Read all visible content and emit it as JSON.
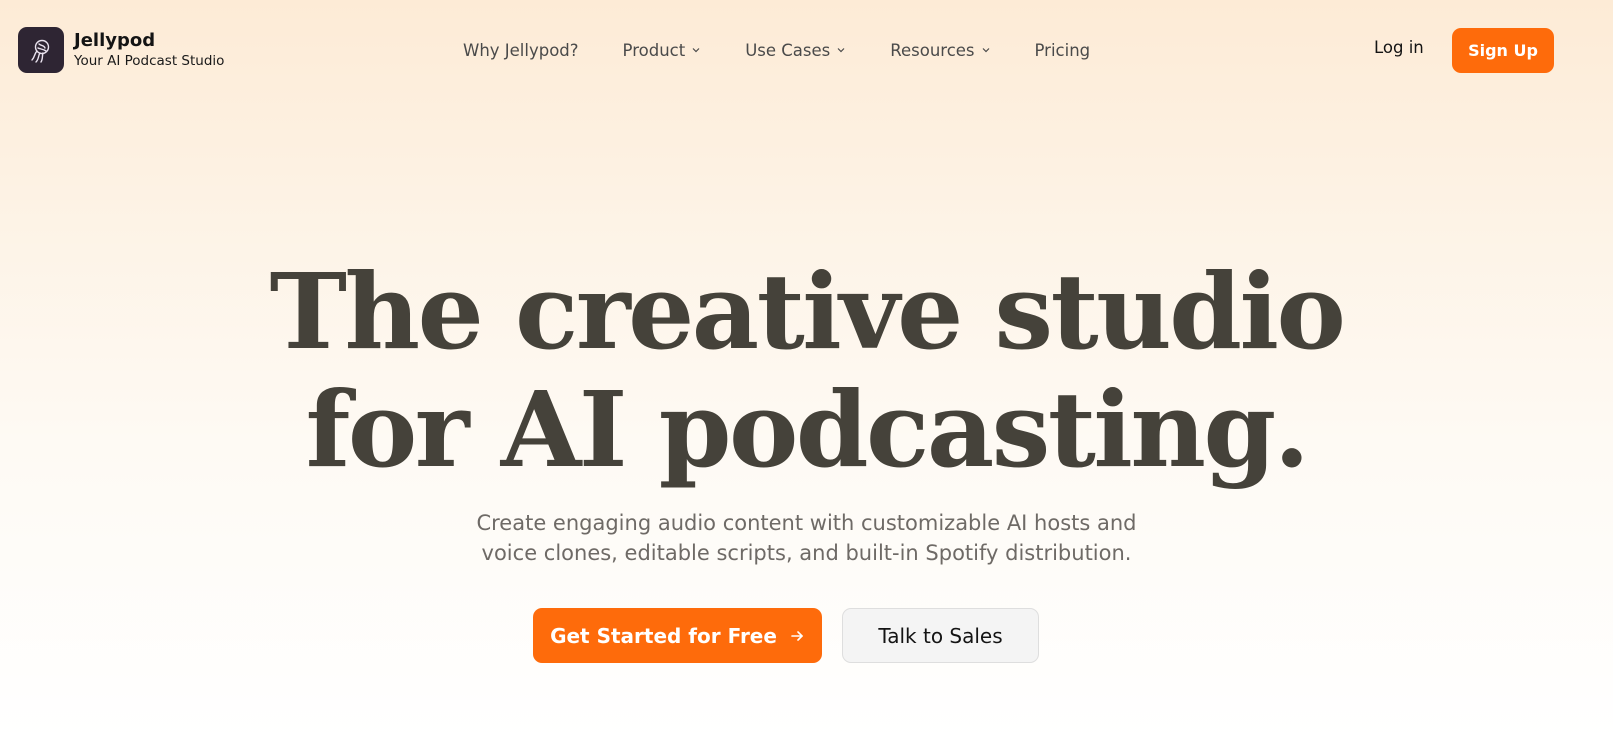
{
  "brand": {
    "name": "Jellypod",
    "tagline": "Your AI Podcast Studio",
    "logo_icon": "jellyfish-logo-icon"
  },
  "nav": {
    "items": [
      {
        "label": "Why Jellypod?",
        "has_dropdown": false
      },
      {
        "label": "Product",
        "has_dropdown": true
      },
      {
        "label": "Use Cases",
        "has_dropdown": true
      },
      {
        "label": "Resources",
        "has_dropdown": true
      },
      {
        "label": "Pricing",
        "has_dropdown": false
      }
    ]
  },
  "auth": {
    "login_label": "Log in",
    "signup_label": "Sign Up"
  },
  "hero": {
    "title_line1": "The creative studio",
    "title_line2": "for AI podcasting.",
    "subtitle_line1": "Create engaging audio content with customizable AI hosts and",
    "subtitle_line2": "voice clones, editable scripts, and built-in Spotify distribution.",
    "primary_cta": "Get Started for Free",
    "secondary_cta": "Talk to Sales"
  },
  "colors": {
    "accent": "#fe6b0b",
    "logo_bg": "#2e2533",
    "heading": "#45423a",
    "subtext": "#6e6a66"
  }
}
